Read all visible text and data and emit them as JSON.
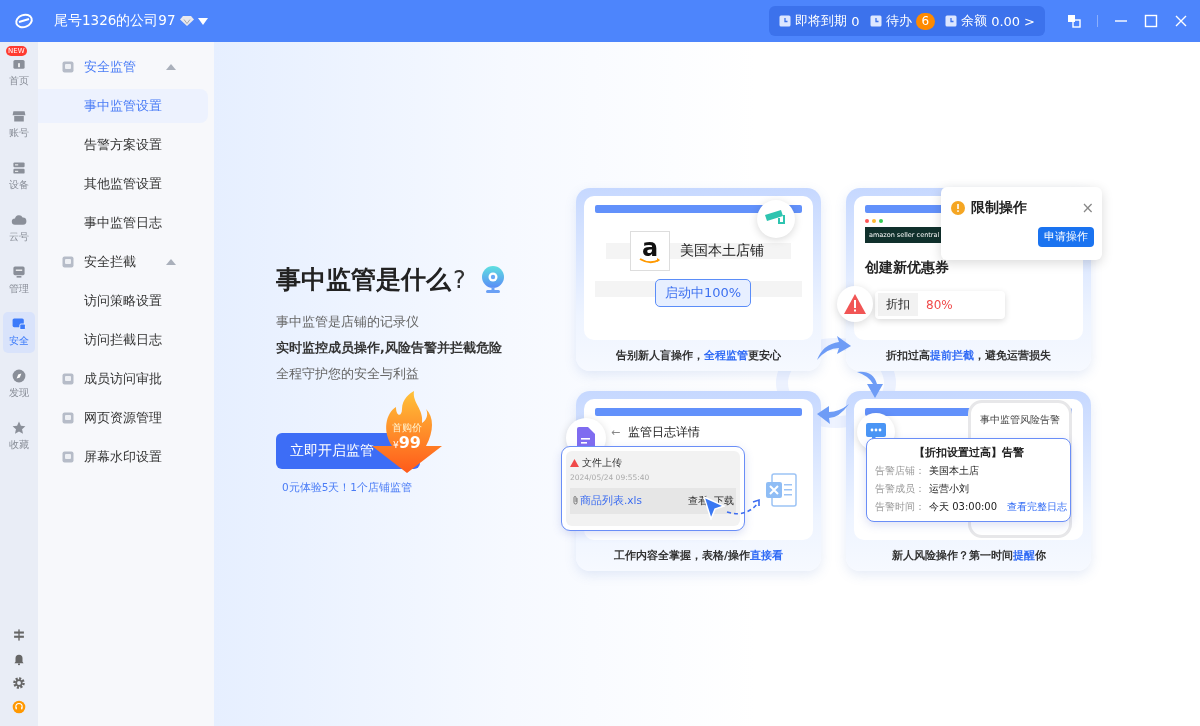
{
  "titlebar": {
    "company": "尾号1326的公司97",
    "status": [
      {
        "kind": "expiry",
        "label": "即将到期",
        "value": "0"
      },
      {
        "kind": "todo",
        "label": "待办",
        "value": "6"
      },
      {
        "kind": "balance",
        "label": "余额",
        "value": "0.00",
        "chevron": ">"
      }
    ]
  },
  "rail": {
    "items": [
      {
        "kind": "home",
        "label": "首页",
        "badge": "NEW",
        "selected": false
      },
      {
        "kind": "store",
        "label": "账号",
        "selected": false
      },
      {
        "kind": "server",
        "label": "设备",
        "selected": false
      },
      {
        "kind": "cloud",
        "label": "云号",
        "selected": false
      },
      {
        "kind": "monitor",
        "label": "管理",
        "selected": false
      },
      {
        "kind": "shield",
        "label": "安全",
        "selected": true
      },
      {
        "kind": "compass",
        "label": "发现",
        "selected": false
      },
      {
        "kind": "star",
        "label": "收藏",
        "selected": false
      }
    ]
  },
  "sidebar": {
    "items": [
      {
        "kind": "group",
        "label": "安全监管",
        "expanded": true,
        "children": [
          {
            "label": "事中监管设置",
            "selected": true
          },
          {
            "label": "告警方案设置",
            "selected": false
          },
          {
            "label": "其他监管设置",
            "selected": false
          },
          {
            "label": "事中监管日志",
            "selected": false
          }
        ]
      },
      {
        "kind": "group",
        "label": "安全拦截",
        "expanded": true,
        "children": [
          {
            "label": "访问策略设置",
            "selected": false
          },
          {
            "label": "访问拦截日志",
            "selected": false
          }
        ]
      },
      {
        "kind": "item",
        "label": "成员访问审批",
        "selected": false
      },
      {
        "kind": "item",
        "label": "网页资源管理",
        "selected": false
      },
      {
        "kind": "item",
        "label": "屏幕水印设置",
        "selected": false
      }
    ]
  },
  "hero": {
    "title": "事中监管是什么",
    "question": "?",
    "lines": [
      {
        "text": "事中监管是店铺的记录仪",
        "emphasis": false
      },
      {
        "text": "实时监控成员操作,风险告警并拦截危险",
        "emphasis": true
      },
      {
        "text": "全程守护您的安全与利益",
        "emphasis": false
      }
    ],
    "button": "立即开启监管",
    "promo": {
      "label": "首购价",
      "currency": "¥",
      "price": "99"
    },
    "note": "0元体验5天！1个店铺监管"
  },
  "illustration": {
    "store_card": {
      "logo": "a",
      "store": "美国本土店铺",
      "status": "启动中100%",
      "caption": {
        "before": "告别新人盲操作，",
        "highlight": "全程监管",
        "after": "更安心"
      }
    },
    "discount_card": {
      "header": "amazon seller central",
      "heading": "创建新优惠券",
      "field_label": "折扣",
      "field_value": "80%",
      "popup": {
        "title": "限制操作",
        "close": "×",
        "action": "申请操作"
      },
      "caption": {
        "before": "折扣过高",
        "highlight": "提前拦截",
        "after": "，避免运营损失"
      }
    },
    "log_card": {
      "back": "←",
      "title": "监管日志详情",
      "event": "文件上传",
      "time": "2024/05/24 09:55:40",
      "file": "商品列表.xls",
      "actions": [
        "查看",
        "下载"
      ],
      "caption": {
        "before": "工作内容全掌握，表格/操作",
        "highlight": "直接看"
      }
    },
    "alert_card": {
      "phone_title": "事中监管风险告警",
      "title": "【折扣设置过高】告警",
      "rows": [
        {
          "label": "告警店铺：",
          "value": "美国本土店"
        },
        {
          "label": "告警成员：",
          "value": "运营小刘"
        },
        {
          "label": "告警时间：",
          "value": "今天  03:00:00",
          "link": "查看完整日志"
        }
      ],
      "caption": {
        "before": "新人风险操作？第一时间",
        "highlight": "提醒",
        "after": "你"
      }
    }
  }
}
